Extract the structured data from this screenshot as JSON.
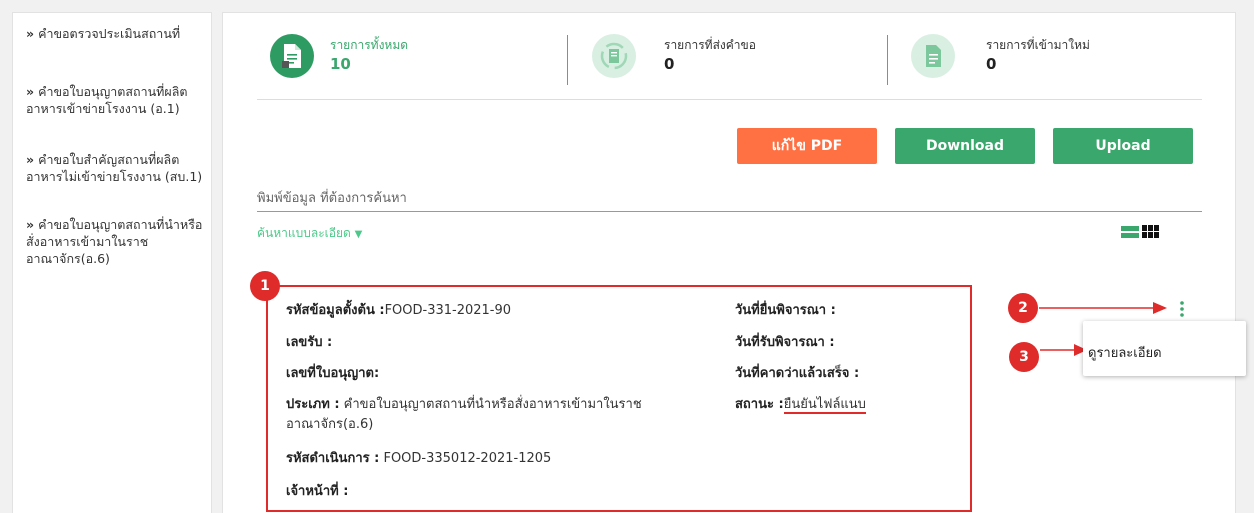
{
  "sidebar": {
    "items": [
      {
        "label": "คำขอตรวจประเมินสถานที่"
      },
      {
        "label": "คำขอใบอนุญาตสถานที่ผลิตอาหารเข้าข่ายโรงงาน (อ.1)"
      },
      {
        "label": "คำขอใบสำคัญสถานที่ผลิตอาหารไม่เข้าข่ายโรงงาน (สบ.1)"
      },
      {
        "label": "คำขอใบอนุญาตสถานที่นำหรือสั่งอาหารเข้ามาในราชอาณาจักร(อ.6)"
      }
    ]
  },
  "stats": [
    {
      "label": "รายการทั้งหมด",
      "value": "10"
    },
    {
      "label": "รายการที่ส่งคำขอ",
      "value": "0"
    },
    {
      "label": "รายการที่เข้ามาใหม่",
      "value": "0"
    }
  ],
  "toolbar": {
    "edit_pdf": "แก้ไข PDF",
    "download": "Download",
    "upload": "Upload"
  },
  "search": {
    "placeholder": "พิมพ์ข้อมูล ที่ต้องการค้นหา",
    "advanced": "ค้นหาแบบละเอียด"
  },
  "record": {
    "origin_code_label": "รหัสข้อมูลตั้งต้น :",
    "origin_code_value": "FOOD-331-2021-90",
    "receive_no_label": "เลขรับ :",
    "license_no_label": "เลขที่ใบอนุญาต:",
    "type_label": "ประเภท :",
    "type_value": "คำขอใบอนุญาตสถานที่นำหรือสั่งอาหารเข้ามาในราชอาณาจักร(อ.6)",
    "process_code_label": "รหัสดำเนินการ :",
    "process_code_value": "FOOD-335012-2021-1205",
    "officer_label": "เจ้าหน้าที่ :",
    "submit_date_label": "วันที่ยื่นพิจารณา :",
    "receive_date_label": "วันที่รับพิจารณา :",
    "expected_date_label": "วันที่คาดว่าแล้วเสร็จ :",
    "status_label": "สถานะ :",
    "status_value": "ยืนยันไฟล์แนบ"
  },
  "menu": {
    "view_detail": "ดูรายละเอียด"
  },
  "badges": [
    "1",
    "2",
    "3"
  ],
  "colors": {
    "green": "#3aa76d",
    "orange": "#ff7043",
    "red": "#e02b2b",
    "link_green": "#4cc98a"
  }
}
